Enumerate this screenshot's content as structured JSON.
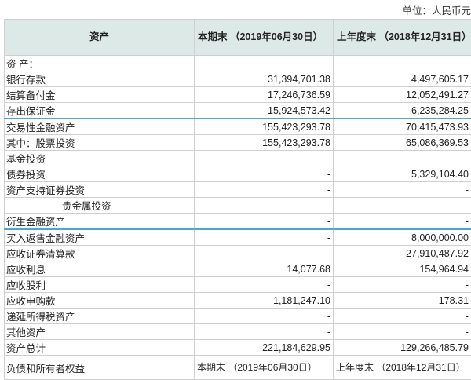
{
  "unit_label": "单位：人民币元",
  "header": {
    "col1": "资产",
    "col2": "本期末 （2019年06月30日）",
    "col3": "上年度末 （2018年12月31日）"
  },
  "rows": [
    {
      "label": "资 产：",
      "current": "",
      "previous": ""
    },
    {
      "label": "银行存款",
      "current": "31,394,701.38",
      "previous": "4,497,605.17"
    },
    {
      "label": "结算备付金",
      "current": "17,246,736.59",
      "previous": "12,052,491.27"
    },
    {
      "label": "存出保证金",
      "current": "15,924,573.42",
      "previous": "6,235,284.25"
    },
    {
      "label": "交易性金融资产",
      "current": "155,423,293.78",
      "previous": "70,415,473.93"
    },
    {
      "label": "其中：股票投资",
      "current": "155,423,293.78",
      "previous": "65,086,369.53"
    },
    {
      "label": "基金投资",
      "current": "-",
      "previous": "-"
    },
    {
      "label": "债券投资",
      "current": "-",
      "previous": "5,329,104.40"
    },
    {
      "label": "资产支持证券投资",
      "current": "-",
      "previous": "-"
    },
    {
      "label": "贵金属投资",
      "current": "-",
      "previous": "-"
    },
    {
      "label": "衍生金融资产",
      "current": "-",
      "previous": "-"
    },
    {
      "label": "买入返售金融资产",
      "current": "-",
      "previous": "8,000,000.00"
    },
    {
      "label": "应收证券清算款",
      "current": "-",
      "previous": "27,910,487.92"
    },
    {
      "label": "应收利息",
      "current": "14,077.68",
      "previous": "154,964.94"
    },
    {
      "label": "应收股利",
      "current": "-",
      "previous": "-"
    },
    {
      "label": "应收申购款",
      "current": "1,181,247.10",
      "previous": "178.31"
    },
    {
      "label": "递延所得税资产",
      "current": "-",
      "previous": "-"
    },
    {
      "label": "其他资产",
      "current": "-",
      "previous": "-"
    },
    {
      "label": "资产总计",
      "current": "221,184,629.95",
      "previous": "129,266,485.79"
    }
  ],
  "footer": {
    "col1": "负债和所有者权益",
    "col2": "本期末 （2019年06月30日）",
    "col3": "上年度末 （2018年12月31日）"
  }
}
